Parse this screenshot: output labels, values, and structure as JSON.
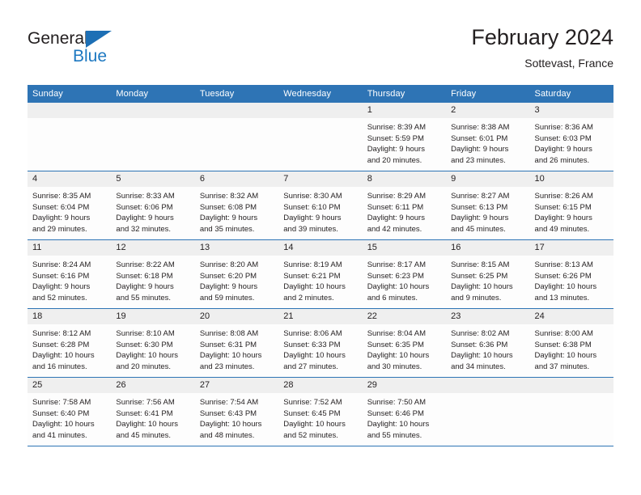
{
  "brand": {
    "name_part1": "General",
    "name_part2": "Blue"
  },
  "header": {
    "title": "February 2024",
    "subtitle": "Sottevast, France"
  },
  "colors": {
    "header_blue": "#2e74b5",
    "logo_blue": "#1d78c1",
    "daynum_gray": "#efefef",
    "text": "#231f20"
  },
  "weekdays": [
    "Sunday",
    "Monday",
    "Tuesday",
    "Wednesday",
    "Thursday",
    "Friday",
    "Saturday"
  ],
  "weeks": [
    [
      {
        "day": "",
        "blank": true,
        "sunrise": "",
        "sunset": "",
        "daylight1": "",
        "daylight2": ""
      },
      {
        "day": "",
        "blank": true,
        "sunrise": "",
        "sunset": "",
        "daylight1": "",
        "daylight2": ""
      },
      {
        "day": "",
        "blank": true,
        "sunrise": "",
        "sunset": "",
        "daylight1": "",
        "daylight2": ""
      },
      {
        "day": "",
        "blank": true,
        "sunrise": "",
        "sunset": "",
        "daylight1": "",
        "daylight2": ""
      },
      {
        "day": "1",
        "blank": false,
        "sunrise": "Sunrise: 8:39 AM",
        "sunset": "Sunset: 5:59 PM",
        "daylight1": "Daylight: 9 hours",
        "daylight2": "and 20 minutes."
      },
      {
        "day": "2",
        "blank": false,
        "sunrise": "Sunrise: 8:38 AM",
        "sunset": "Sunset: 6:01 PM",
        "daylight1": "Daylight: 9 hours",
        "daylight2": "and 23 minutes."
      },
      {
        "day": "3",
        "blank": false,
        "sunrise": "Sunrise: 8:36 AM",
        "sunset": "Sunset: 6:03 PM",
        "daylight1": "Daylight: 9 hours",
        "daylight2": "and 26 minutes."
      }
    ],
    [
      {
        "day": "4",
        "blank": false,
        "sunrise": "Sunrise: 8:35 AM",
        "sunset": "Sunset: 6:04 PM",
        "daylight1": "Daylight: 9 hours",
        "daylight2": "and 29 minutes."
      },
      {
        "day": "5",
        "blank": false,
        "sunrise": "Sunrise: 8:33 AM",
        "sunset": "Sunset: 6:06 PM",
        "daylight1": "Daylight: 9 hours",
        "daylight2": "and 32 minutes."
      },
      {
        "day": "6",
        "blank": false,
        "sunrise": "Sunrise: 8:32 AM",
        "sunset": "Sunset: 6:08 PM",
        "daylight1": "Daylight: 9 hours",
        "daylight2": "and 35 minutes."
      },
      {
        "day": "7",
        "blank": false,
        "sunrise": "Sunrise: 8:30 AM",
        "sunset": "Sunset: 6:10 PM",
        "daylight1": "Daylight: 9 hours",
        "daylight2": "and 39 minutes."
      },
      {
        "day": "8",
        "blank": false,
        "sunrise": "Sunrise: 8:29 AM",
        "sunset": "Sunset: 6:11 PM",
        "daylight1": "Daylight: 9 hours",
        "daylight2": "and 42 minutes."
      },
      {
        "day": "9",
        "blank": false,
        "sunrise": "Sunrise: 8:27 AM",
        "sunset": "Sunset: 6:13 PM",
        "daylight1": "Daylight: 9 hours",
        "daylight2": "and 45 minutes."
      },
      {
        "day": "10",
        "blank": false,
        "sunrise": "Sunrise: 8:26 AM",
        "sunset": "Sunset: 6:15 PM",
        "daylight1": "Daylight: 9 hours",
        "daylight2": "and 49 minutes."
      }
    ],
    [
      {
        "day": "11",
        "blank": false,
        "sunrise": "Sunrise: 8:24 AM",
        "sunset": "Sunset: 6:16 PM",
        "daylight1": "Daylight: 9 hours",
        "daylight2": "and 52 minutes."
      },
      {
        "day": "12",
        "blank": false,
        "sunrise": "Sunrise: 8:22 AM",
        "sunset": "Sunset: 6:18 PM",
        "daylight1": "Daylight: 9 hours",
        "daylight2": "and 55 minutes."
      },
      {
        "day": "13",
        "blank": false,
        "sunrise": "Sunrise: 8:20 AM",
        "sunset": "Sunset: 6:20 PM",
        "daylight1": "Daylight: 9 hours",
        "daylight2": "and 59 minutes."
      },
      {
        "day": "14",
        "blank": false,
        "sunrise": "Sunrise: 8:19 AM",
        "sunset": "Sunset: 6:21 PM",
        "daylight1": "Daylight: 10 hours",
        "daylight2": "and 2 minutes."
      },
      {
        "day": "15",
        "blank": false,
        "sunrise": "Sunrise: 8:17 AM",
        "sunset": "Sunset: 6:23 PM",
        "daylight1": "Daylight: 10 hours",
        "daylight2": "and 6 minutes."
      },
      {
        "day": "16",
        "blank": false,
        "sunrise": "Sunrise: 8:15 AM",
        "sunset": "Sunset: 6:25 PM",
        "daylight1": "Daylight: 10 hours",
        "daylight2": "and 9 minutes."
      },
      {
        "day": "17",
        "blank": false,
        "sunrise": "Sunrise: 8:13 AM",
        "sunset": "Sunset: 6:26 PM",
        "daylight1": "Daylight: 10 hours",
        "daylight2": "and 13 minutes."
      }
    ],
    [
      {
        "day": "18",
        "blank": false,
        "sunrise": "Sunrise: 8:12 AM",
        "sunset": "Sunset: 6:28 PM",
        "daylight1": "Daylight: 10 hours",
        "daylight2": "and 16 minutes."
      },
      {
        "day": "19",
        "blank": false,
        "sunrise": "Sunrise: 8:10 AM",
        "sunset": "Sunset: 6:30 PM",
        "daylight1": "Daylight: 10 hours",
        "daylight2": "and 20 minutes."
      },
      {
        "day": "20",
        "blank": false,
        "sunrise": "Sunrise: 8:08 AM",
        "sunset": "Sunset: 6:31 PM",
        "daylight1": "Daylight: 10 hours",
        "daylight2": "and 23 minutes."
      },
      {
        "day": "21",
        "blank": false,
        "sunrise": "Sunrise: 8:06 AM",
        "sunset": "Sunset: 6:33 PM",
        "daylight1": "Daylight: 10 hours",
        "daylight2": "and 27 minutes."
      },
      {
        "day": "22",
        "blank": false,
        "sunrise": "Sunrise: 8:04 AM",
        "sunset": "Sunset: 6:35 PM",
        "daylight1": "Daylight: 10 hours",
        "daylight2": "and 30 minutes."
      },
      {
        "day": "23",
        "blank": false,
        "sunrise": "Sunrise: 8:02 AM",
        "sunset": "Sunset: 6:36 PM",
        "daylight1": "Daylight: 10 hours",
        "daylight2": "and 34 minutes."
      },
      {
        "day": "24",
        "blank": false,
        "sunrise": "Sunrise: 8:00 AM",
        "sunset": "Sunset: 6:38 PM",
        "daylight1": "Daylight: 10 hours",
        "daylight2": "and 37 minutes."
      }
    ],
    [
      {
        "day": "25",
        "blank": false,
        "sunrise": "Sunrise: 7:58 AM",
        "sunset": "Sunset: 6:40 PM",
        "daylight1": "Daylight: 10 hours",
        "daylight2": "and 41 minutes."
      },
      {
        "day": "26",
        "blank": false,
        "sunrise": "Sunrise: 7:56 AM",
        "sunset": "Sunset: 6:41 PM",
        "daylight1": "Daylight: 10 hours",
        "daylight2": "and 45 minutes."
      },
      {
        "day": "27",
        "blank": false,
        "sunrise": "Sunrise: 7:54 AM",
        "sunset": "Sunset: 6:43 PM",
        "daylight1": "Daylight: 10 hours",
        "daylight2": "and 48 minutes."
      },
      {
        "day": "28",
        "blank": false,
        "sunrise": "Sunrise: 7:52 AM",
        "sunset": "Sunset: 6:45 PM",
        "daylight1": "Daylight: 10 hours",
        "daylight2": "and 52 minutes."
      },
      {
        "day": "29",
        "blank": false,
        "sunrise": "Sunrise: 7:50 AM",
        "sunset": "Sunset: 6:46 PM",
        "daylight1": "Daylight: 10 hours",
        "daylight2": "and 55 minutes."
      },
      {
        "day": "",
        "blank": true,
        "sunrise": "",
        "sunset": "",
        "daylight1": "",
        "daylight2": ""
      },
      {
        "day": "",
        "blank": true,
        "sunrise": "",
        "sunset": "",
        "daylight1": "",
        "daylight2": ""
      }
    ]
  ]
}
